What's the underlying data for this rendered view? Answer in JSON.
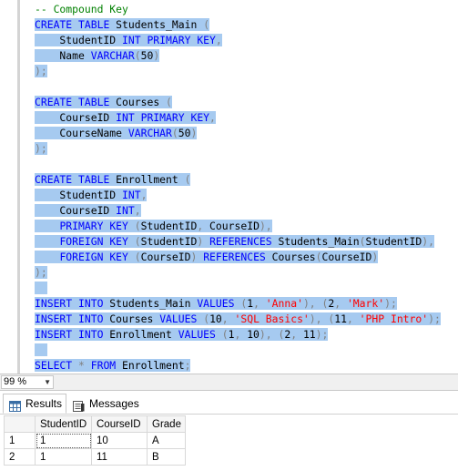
{
  "editor": {
    "lines": [
      {
        "hl": false,
        "tokens": [
          {
            "t": "-- Compound Key",
            "c": "cm"
          }
        ]
      },
      {
        "hl": true,
        "tokens": [
          {
            "t": "CREATE",
            "c": "kw"
          },
          {
            "t": " ",
            "c": "tx"
          },
          {
            "t": "TABLE",
            "c": "kw"
          },
          {
            "t": " Students_Main ",
            "c": "tx"
          },
          {
            "t": "(",
            "c": "gr"
          }
        ]
      },
      {
        "hl": true,
        "tokens": [
          {
            "t": "    StudentID ",
            "c": "tx"
          },
          {
            "t": "INT",
            "c": "kw"
          },
          {
            "t": " ",
            "c": "tx"
          },
          {
            "t": "PRIMARY",
            "c": "kw"
          },
          {
            "t": " ",
            "c": "tx"
          },
          {
            "t": "KEY",
            "c": "kw"
          },
          {
            "t": ",",
            "c": "gr"
          }
        ]
      },
      {
        "hl": true,
        "tokens": [
          {
            "t": "    Name ",
            "c": "tx"
          },
          {
            "t": "VARCHAR",
            "c": "kw"
          },
          {
            "t": "(",
            "c": "gr"
          },
          {
            "t": "50",
            "c": "tx"
          },
          {
            "t": ")",
            "c": "gr"
          }
        ]
      },
      {
        "hl": true,
        "tokens": [
          {
            "t": ");",
            "c": "gr"
          }
        ]
      },
      {
        "hl": false,
        "tokens": []
      },
      {
        "hl": true,
        "tokens": [
          {
            "t": "CREATE",
            "c": "kw"
          },
          {
            "t": " ",
            "c": "tx"
          },
          {
            "t": "TABLE",
            "c": "kw"
          },
          {
            "t": " Courses ",
            "c": "tx"
          },
          {
            "t": "(",
            "c": "gr"
          }
        ]
      },
      {
        "hl": true,
        "tokens": [
          {
            "t": "    CourseID ",
            "c": "tx"
          },
          {
            "t": "INT",
            "c": "kw"
          },
          {
            "t": " ",
            "c": "tx"
          },
          {
            "t": "PRIMARY",
            "c": "kw"
          },
          {
            "t": " ",
            "c": "tx"
          },
          {
            "t": "KEY",
            "c": "kw"
          },
          {
            "t": ",",
            "c": "gr"
          }
        ]
      },
      {
        "hl": true,
        "tokens": [
          {
            "t": "    CourseName ",
            "c": "tx"
          },
          {
            "t": "VARCHAR",
            "c": "kw"
          },
          {
            "t": "(",
            "c": "gr"
          },
          {
            "t": "50",
            "c": "tx"
          },
          {
            "t": ")",
            "c": "gr"
          }
        ]
      },
      {
        "hl": true,
        "tokens": [
          {
            "t": ");",
            "c": "gr"
          }
        ]
      },
      {
        "hl": false,
        "tokens": []
      },
      {
        "hl": true,
        "tokens": [
          {
            "t": "CREATE",
            "c": "kw"
          },
          {
            "t": " ",
            "c": "tx"
          },
          {
            "t": "TABLE",
            "c": "kw"
          },
          {
            "t": " Enrollment ",
            "c": "tx"
          },
          {
            "t": "(",
            "c": "gr"
          }
        ]
      },
      {
        "hl": true,
        "tokens": [
          {
            "t": "    StudentID ",
            "c": "tx"
          },
          {
            "t": "INT",
            "c": "kw"
          },
          {
            "t": ",",
            "c": "gr"
          }
        ]
      },
      {
        "hl": true,
        "tokens": [
          {
            "t": "    CourseID ",
            "c": "tx"
          },
          {
            "t": "INT",
            "c": "kw"
          },
          {
            "t": ",",
            "c": "gr"
          }
        ]
      },
      {
        "hl": true,
        "tokens": [
          {
            "t": "    ",
            "c": "tx"
          },
          {
            "t": "PRIMARY",
            "c": "kw"
          },
          {
            "t": " ",
            "c": "tx"
          },
          {
            "t": "KEY",
            "c": "kw"
          },
          {
            "t": " ",
            "c": "tx"
          },
          {
            "t": "(",
            "c": "gr"
          },
          {
            "t": "StudentID",
            "c": "tx"
          },
          {
            "t": ",",
            "c": "gr"
          },
          {
            "t": " CourseID",
            "c": "tx"
          },
          {
            "t": "),",
            "c": "gr"
          }
        ]
      },
      {
        "hl": true,
        "tokens": [
          {
            "t": "    ",
            "c": "tx"
          },
          {
            "t": "FOREIGN",
            "c": "kw"
          },
          {
            "t": " ",
            "c": "tx"
          },
          {
            "t": "KEY",
            "c": "kw"
          },
          {
            "t": " ",
            "c": "tx"
          },
          {
            "t": "(",
            "c": "gr"
          },
          {
            "t": "StudentID",
            "c": "tx"
          },
          {
            "t": ")",
            "c": "gr"
          },
          {
            "t": " ",
            "c": "tx"
          },
          {
            "t": "REFERENCES",
            "c": "kw"
          },
          {
            "t": " Students_Main",
            "c": "tx"
          },
          {
            "t": "(",
            "c": "gr"
          },
          {
            "t": "StudentID",
            "c": "tx"
          },
          {
            "t": "),",
            "c": "gr"
          }
        ]
      },
      {
        "hl": true,
        "tokens": [
          {
            "t": "    ",
            "c": "tx"
          },
          {
            "t": "FOREIGN",
            "c": "kw"
          },
          {
            "t": " ",
            "c": "tx"
          },
          {
            "t": "KEY",
            "c": "kw"
          },
          {
            "t": " ",
            "c": "tx"
          },
          {
            "t": "(",
            "c": "gr"
          },
          {
            "t": "CourseID",
            "c": "tx"
          },
          {
            "t": ")",
            "c": "gr"
          },
          {
            "t": " ",
            "c": "tx"
          },
          {
            "t": "REFERENCES",
            "c": "kw"
          },
          {
            "t": " Courses",
            "c": "tx"
          },
          {
            "t": "(",
            "c": "gr"
          },
          {
            "t": "CourseID",
            "c": "tx"
          },
          {
            "t": ")",
            "c": "gr"
          }
        ]
      },
      {
        "hl": true,
        "tokens": [
          {
            "t": ");",
            "c": "gr"
          }
        ]
      },
      {
        "hl": true,
        "tokens": []
      },
      {
        "hl": true,
        "tokens": [
          {
            "t": "INSERT",
            "c": "kw"
          },
          {
            "t": " ",
            "c": "tx"
          },
          {
            "t": "INTO",
            "c": "kw"
          },
          {
            "t": " Students_Main ",
            "c": "tx"
          },
          {
            "t": "VALUES",
            "c": "kw"
          },
          {
            "t": " ",
            "c": "tx"
          },
          {
            "t": "(",
            "c": "gr"
          },
          {
            "t": "1",
            "c": "tx"
          },
          {
            "t": ",",
            "c": "gr"
          },
          {
            "t": " ",
            "c": "tx"
          },
          {
            "t": "'Anna'",
            "c": "str"
          },
          {
            "t": "),",
            "c": "gr"
          },
          {
            "t": " ",
            "c": "tx"
          },
          {
            "t": "(",
            "c": "gr"
          },
          {
            "t": "2",
            "c": "tx"
          },
          {
            "t": ",",
            "c": "gr"
          },
          {
            "t": " ",
            "c": "tx"
          },
          {
            "t": "'Mark'",
            "c": "str"
          },
          {
            "t": ");",
            "c": "gr"
          }
        ]
      },
      {
        "hl": true,
        "tokens": [
          {
            "t": "INSERT",
            "c": "kw"
          },
          {
            "t": " ",
            "c": "tx"
          },
          {
            "t": "INTO",
            "c": "kw"
          },
          {
            "t": " Courses ",
            "c": "tx"
          },
          {
            "t": "VALUES",
            "c": "kw"
          },
          {
            "t": " ",
            "c": "tx"
          },
          {
            "t": "(",
            "c": "gr"
          },
          {
            "t": "10",
            "c": "tx"
          },
          {
            "t": ",",
            "c": "gr"
          },
          {
            "t": " ",
            "c": "tx"
          },
          {
            "t": "'SQL Basics'",
            "c": "str"
          },
          {
            "t": "),",
            "c": "gr"
          },
          {
            "t": " ",
            "c": "tx"
          },
          {
            "t": "(",
            "c": "gr"
          },
          {
            "t": "11",
            "c": "tx"
          },
          {
            "t": ",",
            "c": "gr"
          },
          {
            "t": " ",
            "c": "tx"
          },
          {
            "t": "'PHP Intro'",
            "c": "str"
          },
          {
            "t": ");",
            "c": "gr"
          }
        ]
      },
      {
        "hl": true,
        "tokens": [
          {
            "t": "INSERT",
            "c": "kw"
          },
          {
            "t": " ",
            "c": "tx"
          },
          {
            "t": "INTO",
            "c": "kw"
          },
          {
            "t": " Enrollment ",
            "c": "tx"
          },
          {
            "t": "VALUES",
            "c": "kw"
          },
          {
            "t": " ",
            "c": "tx"
          },
          {
            "t": "(",
            "c": "gr"
          },
          {
            "t": "1",
            "c": "tx"
          },
          {
            "t": ",",
            "c": "gr"
          },
          {
            "t": " ",
            "c": "tx"
          },
          {
            "t": "10",
            "c": "tx"
          },
          {
            "t": "),",
            "c": "gr"
          },
          {
            "t": " ",
            "c": "tx"
          },
          {
            "t": "(",
            "c": "gr"
          },
          {
            "t": "2",
            "c": "tx"
          },
          {
            "t": ",",
            "c": "gr"
          },
          {
            "t": " ",
            "c": "tx"
          },
          {
            "t": "11",
            "c": "tx"
          },
          {
            "t": ");",
            "c": "gr"
          }
        ]
      },
      {
        "hl": true,
        "tokens": []
      },
      {
        "hl": true,
        "tokens": [
          {
            "t": "SELECT",
            "c": "kw"
          },
          {
            "t": " ",
            "c": "tx"
          },
          {
            "t": "*",
            "c": "gr"
          },
          {
            "t": " ",
            "c": "tx"
          },
          {
            "t": "FROM",
            "c": "kw"
          },
          {
            "t": " Enrollment",
            "c": "tx"
          },
          {
            "t": ";",
            "c": "gr"
          }
        ]
      }
    ]
  },
  "toolbar": {
    "zoom_value": "99 %"
  },
  "results": {
    "tabs": [
      {
        "label": "Results",
        "icon": "grid-icon",
        "active": true
      },
      {
        "label": "Messages",
        "icon": "messages-icon",
        "active": false
      }
    ],
    "columns": [
      "",
      "StudentID",
      "CourseID",
      "Grade"
    ],
    "rows": [
      [
        "1",
        "1",
        "10",
        "A"
      ],
      [
        "2",
        "1",
        "11",
        "B"
      ]
    ]
  },
  "colors": {
    "selection": "#a6caf0",
    "keyword": "#0000ff",
    "string": "#ff0000",
    "comment": "#008000",
    "operator": "#808080"
  }
}
